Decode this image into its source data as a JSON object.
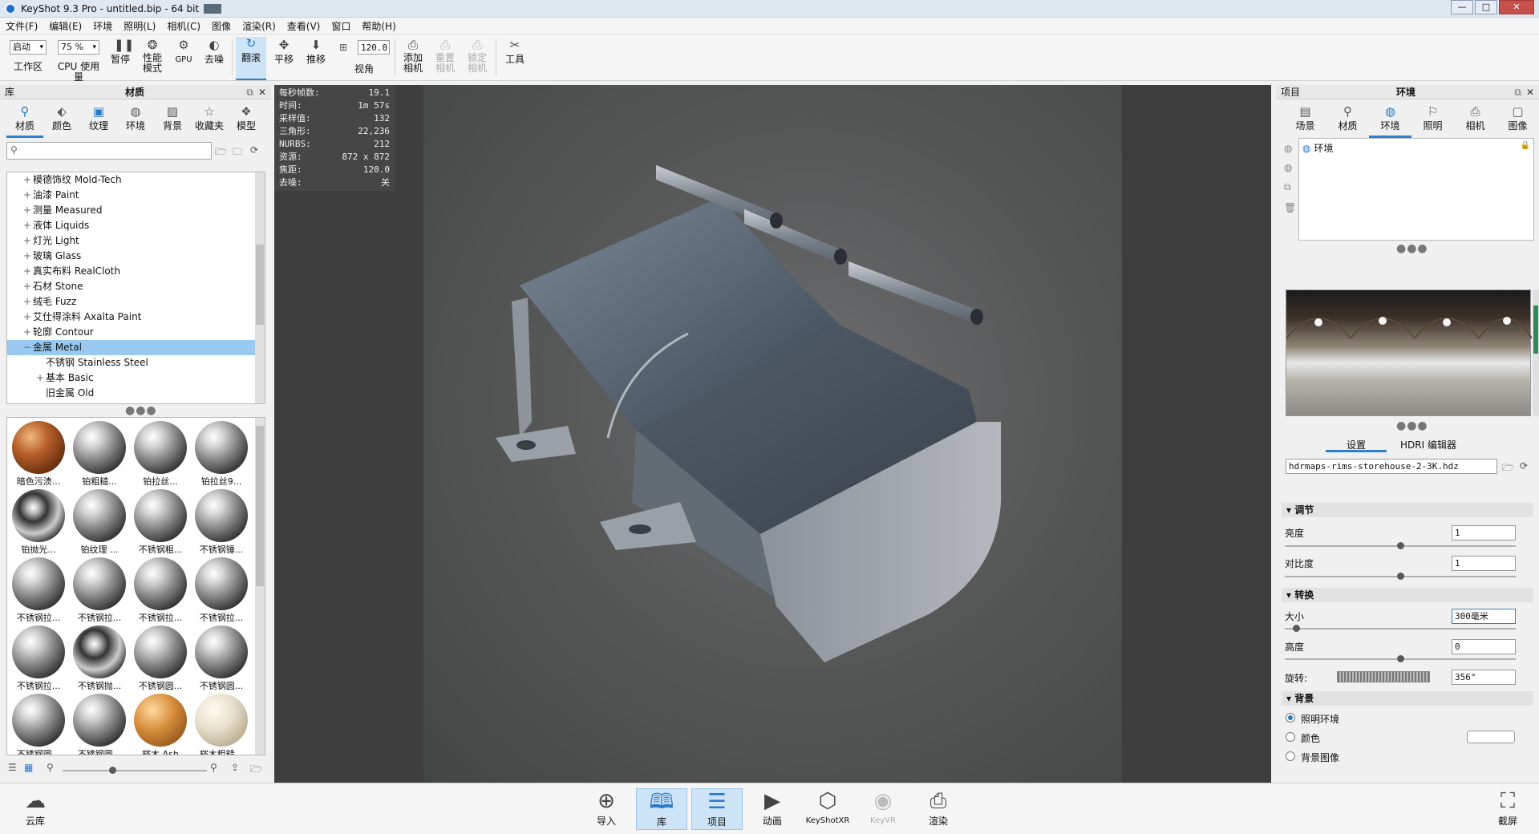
{
  "window": {
    "title": "KeyShot 9.3 Pro  - untitled.bip - 64 bit",
    "min": "—",
    "max": "□",
    "close": "✕"
  },
  "menu": [
    "文件(F)",
    "编辑(E)",
    "环境",
    "照明(L)",
    "相机(C)",
    "图像",
    "渲染(R)",
    "查看(V)",
    "窗口",
    "帮助(H)"
  ],
  "toolbar": {
    "start_select": "启动",
    "zoom_select": "75 %",
    "fov_value": "120.0",
    "items": [
      {
        "label": "工作区",
        "icon": "workspace-icon"
      },
      {
        "label": "CPU 使用量",
        "icon": "cpu-icon"
      },
      {
        "label": "暂停",
        "icon": "pause-icon"
      },
      {
        "label": "性能模式",
        "icon": "performance-icon"
      },
      {
        "label": "GPU",
        "icon": "gpu-icon"
      },
      {
        "label": "去噪",
        "icon": "denoise-icon"
      },
      {
        "label": "翻滚",
        "icon": "tumble-icon"
      },
      {
        "label": "平移",
        "icon": "pan-icon"
      },
      {
        "label": "推移",
        "icon": "dolly-icon"
      },
      {
        "label": "视角",
        "icon": "fov-icon"
      },
      {
        "label": "添加相机",
        "icon": "add-camera-icon"
      },
      {
        "label": "重置相机",
        "icon": "reset-camera-icon"
      },
      {
        "label": "锁定相机",
        "icon": "lock-camera-icon"
      },
      {
        "label": "工具",
        "icon": "tools-icon"
      }
    ]
  },
  "library": {
    "header": "库",
    "title": "材质",
    "tabs": [
      "材质",
      "颜色",
      "纹理",
      "环境",
      "背景",
      "收藏夹",
      "模型"
    ],
    "search_placeholder": "",
    "tree": [
      {
        "pm": "+",
        "label": "模德饰纹 Mold-Tech",
        "indent": 1
      },
      {
        "pm": "+",
        "label": "油漆 Paint",
        "indent": 1
      },
      {
        "pm": "+",
        "label": "测量 Measured",
        "indent": 1
      },
      {
        "pm": "+",
        "label": "液体 Liquids",
        "indent": 1
      },
      {
        "pm": "+",
        "label": "灯光 Light",
        "indent": 1
      },
      {
        "pm": "+",
        "label": "玻璃 Glass",
        "indent": 1
      },
      {
        "pm": "+",
        "label": "真实布料 RealCloth",
        "indent": 1
      },
      {
        "pm": "+",
        "label": "石材 Stone",
        "indent": 1
      },
      {
        "pm": "+",
        "label": "绒毛 Fuzz",
        "indent": 1
      },
      {
        "pm": "+",
        "label": "艾仕得涂料 Axalta Paint",
        "indent": 1
      },
      {
        "pm": "+",
        "label": "轮廓 Contour",
        "indent": 1
      },
      {
        "pm": "−",
        "label": "金属 Metal",
        "indent": 1,
        "selected": true
      },
      {
        "pm": "",
        "label": "不锈钢 Stainless Steel",
        "indent": 2
      },
      {
        "pm": "+",
        "label": "基本 Basic",
        "indent": 2
      },
      {
        "pm": "",
        "label": "旧金属 Old",
        "indent": 2
      }
    ],
    "materials": [
      "暗色污渍...",
      "铂粗糙...",
      "铂拉丝...",
      "铂拉丝9...",
      "铂抛光...",
      "铂纹理 ...",
      "不锈钢粗...",
      "不锈钢锤...",
      "不锈钢拉...",
      "不锈钢拉...",
      "不锈钢拉...",
      "不锈钢拉...",
      "不锈钢拉...",
      "不锈钢抛...",
      "不锈钢圆...",
      "不锈钢圆...",
      "不锈钢圆...",
      "不锈钢圆...",
      "梣木 Ash",
      "梣木粗糙..."
    ]
  },
  "stats": [
    {
      "k": "每秒帧数:",
      "v": "19.1"
    },
    {
      "k": "时间:",
      "v": "1m 57s"
    },
    {
      "k": "采样值:",
      "v": "132"
    },
    {
      "k": "三角形:",
      "v": "22,236"
    },
    {
      "k": "NURBS:",
      "v": "212"
    },
    {
      "k": "资源:",
      "v": "872 x 872"
    },
    {
      "k": "焦距:",
      "v": "120.0"
    },
    {
      "k": "去噪:",
      "v": "关"
    }
  ],
  "project": {
    "header": "项目",
    "title": "环境",
    "tabs": [
      "场景",
      "材质",
      "环境",
      "照明",
      "相机",
      "图像"
    ],
    "env_item": "环境",
    "subtabs": [
      "设置",
      "HDRI 编辑器"
    ],
    "hdr_file": "hdrmaps-rims-storehouse-2-3K.hdz",
    "sections": {
      "adjust": "调节",
      "transform": "转换",
      "background": "背景"
    },
    "brightness_label": "亮度",
    "brightness": "1",
    "brightness_pct": 0.5,
    "contrast_label": "对比度",
    "contrast": "1",
    "contrast_pct": 0.5,
    "size_label": "大小",
    "size": "300毫米",
    "size_pct": 0.05,
    "height_label": "高度",
    "height": "0",
    "height_pct": 0.5,
    "rotation_label": "旋转:",
    "rotation": "356°",
    "bg_options": [
      "照明环境",
      "颜色",
      "背景图像"
    ],
    "bg_selected": 0
  },
  "bottom": [
    "云库",
    "导入",
    "库",
    "项目",
    "动画",
    "KeyShotXR",
    "KeyVR",
    "渲染",
    "截屏"
  ]
}
